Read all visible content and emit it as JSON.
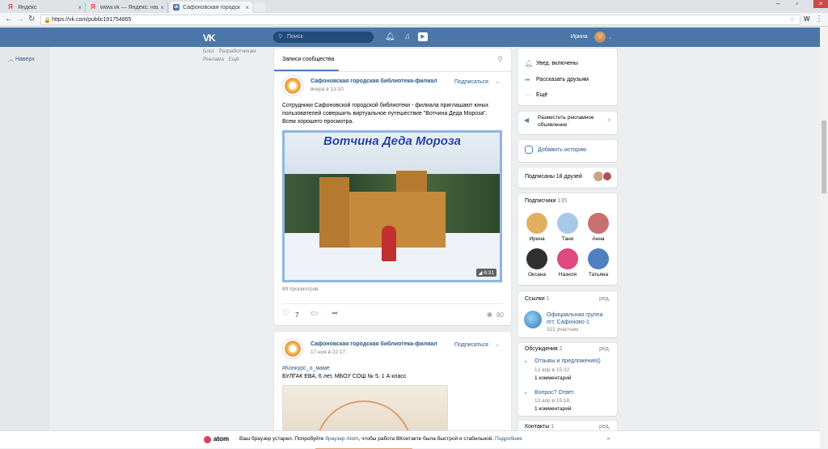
{
  "browser": {
    "tabs": [
      {
        "title": "Яндекс"
      },
      {
        "title": "www.vk — Яндекс: нашл"
      },
      {
        "title": "Сафоновская городск"
      }
    ],
    "url": "https://vk.com/public191754865",
    "url_lock_icon": "lock-icon"
  },
  "vk": {
    "search_placeholder": "Поиск",
    "user_name": "Ирина",
    "back_label": "Наверх",
    "mini_links": [
      "Блог",
      "Разработчикам",
      "Реклама",
      "Ещё"
    ]
  },
  "feed": {
    "tab_label": "Записи сообщества",
    "posts": [
      {
        "author": "Сафоновская городская библиотека-филиал",
        "time": "вчера в 13:10",
        "subscribe": "Подписаться",
        "text_lines": [
          "Сотрудники Сафоновской городской библиотеки - филиала приглашают юных",
          "пользователей совершить виртуальное путешествие \"Вотчина Деда Мороза\".",
          "Всем хорошего просмотра."
        ],
        "video_title": "Вотчина Деда Мороза",
        "video_duration": "6:31",
        "views_text": "89 просмотров",
        "likes": "7",
        "views_count": "80"
      },
      {
        "author": "Сафоновская городская библиотека-филиал",
        "time": "17 ноя в 22:17",
        "subscribe": "Подписаться",
        "text_lines": [
          "#Конкурс_о_маме",
          "БУЛГАК ЕВА, 6 лет, МБОУ СОШ № 5, 1 А класс"
        ]
      }
    ]
  },
  "sidebar": {
    "menu": [
      "Увед. включены",
      "Рассказать друзьям",
      "Ещё"
    ],
    "ad": "Разместить рекламное объявление",
    "story": "Добавить историю",
    "friends_subscribed": "Подписаны 18 друзей",
    "subscribers_title": "Подписчики",
    "subscribers_count": "135",
    "subscribers": [
      {
        "name": "Ирина",
        "color": "#e0b060"
      },
      {
        "name": "Таня",
        "color": "#a8c8e8"
      },
      {
        "name": "Анна",
        "color": "#c87070"
      },
      {
        "name": "Оксана",
        "color": "#303030"
      },
      {
        "name": "Назиля",
        "color": "#e04880"
      },
      {
        "name": "Татьяна",
        "color": "#5080c0"
      }
    ],
    "links_title": "Ссылки",
    "links_count": "1",
    "edit": "ред.",
    "link_name_1": "Официальная группа",
    "link_name_2": "пгт. Сафоново-1",
    "link_members": "321 участник",
    "discussions_title": "Обсуждения",
    "discussions_count": "2",
    "discussions": [
      {
        "title": "Отзывы и предложения))",
        "date": "13 апр в 15:22",
        "comments": "1 комментарий"
      },
      {
        "title": "Вопрос? Ответ.",
        "date": "13 апр в 15:18",
        "comments": "1 комментарий"
      }
    ],
    "contacts_title": "Контакты",
    "contacts_count": "1"
  },
  "banner": {
    "brand": "atom",
    "text_before": "Ваш браузер устарел. Попробуйте",
    "link1": "браузер Atom",
    "text_after": ", чтобы работа ВКонтакте была быстрой и стабильной.",
    "link2": "Подробнее"
  }
}
